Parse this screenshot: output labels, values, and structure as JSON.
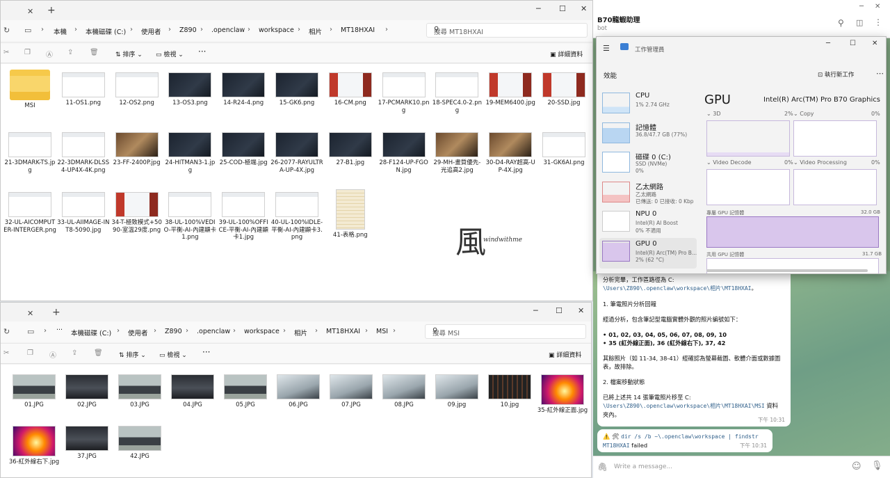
{
  "explorer1": {
    "tab_close": "✕",
    "tab_add": "+",
    "breadcrumb": [
      "本機",
      "本機磁碟 (C:)",
      "使用者",
      "Z890",
      ".openclaw",
      "workspace",
      "相片",
      "MT18HXAI"
    ],
    "search_placeholder": "搜尋 MT18HXAI",
    "sort_label": "排序",
    "view_label": "檢視",
    "more_label": "···",
    "details_label": "詳細資料",
    "files": [
      {
        "name": "MSI",
        "kind": "folder"
      },
      {
        "name": "11-OS1.png",
        "kind": "white"
      },
      {
        "name": "12-OS2.png",
        "kind": "white"
      },
      {
        "name": "13-OS3.png",
        "kind": "dark"
      },
      {
        "name": "14-R24-4.png",
        "kind": "dark"
      },
      {
        "name": "15-GK6.png",
        "kind": "dark"
      },
      {
        "name": "16-CM.png",
        "kind": "color"
      },
      {
        "name": "17-PCMARK10.png",
        "kind": "white"
      },
      {
        "name": "18-SPEC4.0-2.png",
        "kind": "white"
      },
      {
        "name": "19-MEM6400.jpg",
        "kind": "color"
      },
      {
        "name": "20-SSD.jpg",
        "kind": "color"
      },
      {
        "name": "21-3DMARK-TS.jpg",
        "kind": "white"
      },
      {
        "name": "22-3DMARK-DLSS4-UP4X-4K.png",
        "kind": "white"
      },
      {
        "name": "23-FF-2400P.jpg",
        "kind": "game"
      },
      {
        "name": "24-HITMAN3-1.jpg",
        "kind": "dark"
      },
      {
        "name": "25-COD-極端.jpg",
        "kind": "dark"
      },
      {
        "name": "26-2077-RAYULTRA-UP-4X.jpg",
        "kind": "dark"
      },
      {
        "name": "27-B1.jpg",
        "kind": "dark"
      },
      {
        "name": "28-F124-UP-FGON.jpg",
        "kind": "dark"
      },
      {
        "name": "29-MH-畫質優先-光追高2.jpg",
        "kind": "game"
      },
      {
        "name": "30-D4-RAY超高-UP-4X.jpg",
        "kind": "game"
      },
      {
        "name": "31-GK6AI.png",
        "kind": "white"
      },
      {
        "name": "32-UL-AICOMPUTER-INTERGER.png",
        "kind": "white"
      },
      {
        "name": "33-UL-AIIMAGE-INT8-5090.jpg",
        "kind": "white"
      },
      {
        "name": "34-T-極致模式+5090-室溫29度.png",
        "kind": "color"
      },
      {
        "name": "38-UL-100%VEDIO-平衡-AI-內建顯卡1.png",
        "kind": "white"
      },
      {
        "name": "39-UL-100%OFFICE-平衡-AI-內建顯卡1.jpg",
        "kind": "white"
      },
      {
        "name": "40-UL-100%IDLE-平衡-AI-內建顯卡3.png",
        "kind": "white"
      },
      {
        "name": "41-表格.png",
        "kind": "table"
      }
    ]
  },
  "explorer2": {
    "tab_close": "✕",
    "tab_add": "+",
    "breadcrumb": [
      "本機磁碟 (C:)",
      "使用者",
      "Z890",
      ".openclaw",
      "workspace",
      "相片",
      "MT18HXAI",
      "MSI"
    ],
    "search_placeholder": "搜尋 MSI",
    "sort_label": "排序",
    "view_label": "檢視",
    "more_label": "···",
    "details_label": "詳細資料",
    "files": [
      {
        "name": "01.JPG",
        "kind": "laptop"
      },
      {
        "name": "02.JPG",
        "kind": "laptop-dark"
      },
      {
        "name": "03.JPG",
        "kind": "laptop"
      },
      {
        "name": "04.JPG",
        "kind": "laptop-dark"
      },
      {
        "name": "05.JPG",
        "kind": "laptop"
      },
      {
        "name": "06.JPG",
        "kind": "laptop-bright"
      },
      {
        "name": "07.JPG",
        "kind": "laptop-bright"
      },
      {
        "name": "08.JPG",
        "kind": "laptop-bright"
      },
      {
        "name": "09.jpg",
        "kind": "laptop-bright"
      },
      {
        "name": "10.jpg",
        "kind": "laptop-keys"
      },
      {
        "name": "35-紅外線正面.jpg",
        "kind": "thermal"
      },
      {
        "name": "36-紅外線右下.jpg",
        "kind": "thermal"
      },
      {
        "name": "37.JPG",
        "kind": "laptop-dark"
      },
      {
        "name": "42.JPG",
        "kind": "laptop"
      }
    ]
  },
  "telegram": {
    "chat_title": "B70龍蝦助理",
    "chat_status": "bot",
    "message1": {
      "line1": "分析完畢，工作區路徑為 C:",
      "path1": "\\Users\\Z890\\.openclaw\\workspace\\相片\\MT18HXAI",
      "path1_end": "。",
      "heading1": "1. 筆電照片分析回報",
      "para1": "經過分析，包含筆記型電腦實體外觀的照片編號如下：",
      "bullet1": "• 01, 02, 03, 04, 05, 06, 07, 08, 09, 10",
      "bullet2": "• 35 (紅外線正面), 36 (紅外線右下), 37, 42",
      "para2a": "其餘照片（如 11-34, 38-41）經確認為螢幕截圖、軟體介面或數據圖",
      "para2b": "表，故排除。",
      "heading2": "2. 檔案移動狀態",
      "para3": "已將上述共 14 張筆電照片移至 C:",
      "path2": "\\Users\\Z890\\.openclaw\\workspace\\相片\\MT18HXAI\\MSI",
      "path2_end": " 資料",
      "para3b": "夾內。",
      "time": "下午 10:31"
    },
    "message2": {
      "icons": "⚠️ 🛠",
      "cmd": "dir /s /b ~\\.openclaw\\workspace | findstr",
      "cmd2": "MT18HXAI",
      "status": " failed",
      "time": "下午 10:31"
    },
    "input_placeholder": "Write a message..."
  },
  "taskmgr": {
    "app_title": "工作管理員",
    "section": "效能",
    "new_task": "執行新工作",
    "resources": [
      {
        "name": "CPU",
        "l1": "1% 2.74 GHz",
        "l2": ""
      },
      {
        "name": "記憶體",
        "l1": "36.8/47.7 GB (77%)",
        "l2": ""
      },
      {
        "name": "磁碟 0 (C:)",
        "l1": "SSD (NVMe)",
        "l2": "0%"
      },
      {
        "name": "乙太網路",
        "l1": "乙太網路",
        "l2": "已傳送: 0 已接收: 0 Kbp"
      },
      {
        "name": "NPU 0",
        "l1": "Intel(R) AI Boost",
        "l2": "0% 不適用"
      },
      {
        "name": "GPU 0",
        "l1": "Intel(R) Arc(TM) Pro B...",
        "l2": "2% (62 °C)"
      }
    ],
    "gpu_title": "GPU",
    "gpu_model": "Intel(R) Arc(TM) Pro B70 Graphics",
    "engines": [
      {
        "name": "3D",
        "pct": "2%"
      },
      {
        "name": "Copy",
        "pct": "0%"
      },
      {
        "name": "Video Decode",
        "pct": "0%"
      },
      {
        "name": "Video Processing",
        "pct": "0%"
      }
    ],
    "dedicated_label": "專屬 GPU 記憶體",
    "dedicated_value": "32.0 GB",
    "shared_label": "共用 GPU 記憶體",
    "shared_value": "31.7 GB"
  },
  "watermark": {
    "glyph": "風",
    "text": "windwithme"
  }
}
